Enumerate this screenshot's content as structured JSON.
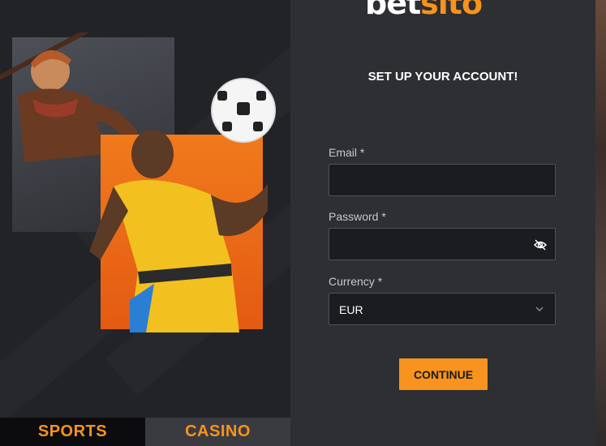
{
  "brand": {
    "logo_part1": "bet",
    "logo_part2": "sito",
    "accent": "#f7931e"
  },
  "promo": {
    "tabs": [
      {
        "label": "SPORTS"
      },
      {
        "label": "CASINO"
      }
    ]
  },
  "form": {
    "heading": "SET UP YOUR ACCOUNT!",
    "email": {
      "label": "Email *",
      "value": "",
      "placeholder": ""
    },
    "password": {
      "label": "Password *",
      "value": "",
      "placeholder": "",
      "toggle_icon": "eye-slash-icon"
    },
    "currency": {
      "label": "Currency *",
      "value": "EUR",
      "icon": "chevron-down-icon"
    },
    "continue_label": "CONTINUE"
  }
}
